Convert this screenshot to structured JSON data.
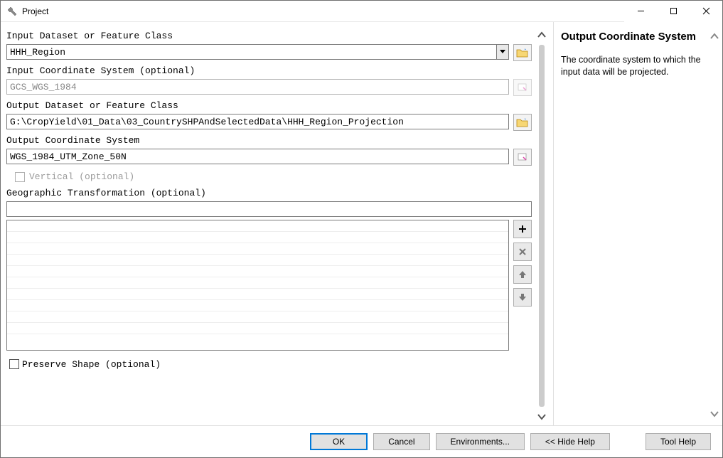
{
  "window": {
    "title": "Project"
  },
  "fields": {
    "input_dataset": {
      "label": "Input Dataset or Feature Class",
      "value": "HHH_Region"
    },
    "input_cs": {
      "label": "Input Coordinate System (optional)",
      "value": "GCS_WGS_1984"
    },
    "output_dataset": {
      "label": "Output Dataset or Feature Class",
      "value": "G:\\CropYield\\01_Data\\03_CountrySHPAndSelectedData\\HHH_Region_Projection"
    },
    "output_cs": {
      "label": "Output Coordinate System",
      "value": "WGS_1984_UTM_Zone_50N"
    },
    "vertical": {
      "label": "Vertical (optional)"
    },
    "geo_trans": {
      "label": "Geographic Transformation (optional)",
      "value": ""
    },
    "preserve_shape": {
      "label": "Preserve Shape (optional)"
    }
  },
  "buttons": {
    "ok": "OK",
    "cancel": "Cancel",
    "environments": "Environments...",
    "hide_help": "<< Hide Help",
    "tool_help": "Tool Help"
  },
  "help": {
    "title": "Output Coordinate System",
    "desc": "The coordinate system to which the input data will be projected."
  }
}
